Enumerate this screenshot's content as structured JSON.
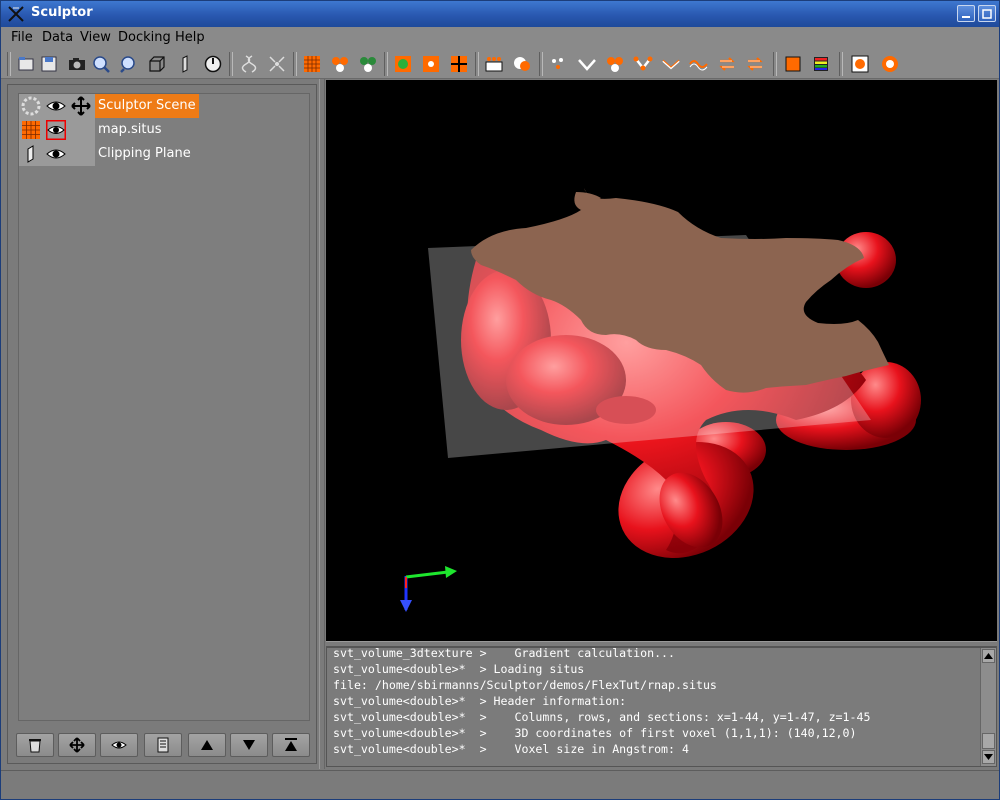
{
  "window": {
    "title": "Sculptor"
  },
  "menubar": {
    "items": [
      "File",
      "Data",
      "View",
      "Docking",
      "Help"
    ]
  },
  "toolbar": {
    "buttons": [
      "open-file-icon",
      "save-file-icon",
      "screenshot-icon",
      "zoom-in-icon",
      "zoom-out-icon",
      "box-icon",
      "clipping-plane-icon",
      "clock-icon",
      "dna-icon",
      "move-icon",
      "volume-grid-icon",
      "atoms-red-icon",
      "atoms-green-icon",
      "node-icon",
      "marker-grid-icon",
      "crosshair-icon",
      "piano-icon",
      "sphere-pair-icon",
      "points-icon",
      "connect-v-icon",
      "cluster-icon",
      "tree-icon",
      "chevron-icon",
      "wave-icon",
      "swap-icon",
      "swap-alt-icon",
      "orange-square-icon",
      "palette-icon",
      "render-icon",
      "settings-render-icon"
    ]
  },
  "tree": {
    "items": [
      {
        "label": "Sculptor Scene",
        "selected": true
      },
      {
        "label": "map.situs",
        "selected": false
      },
      {
        "label": "Clipping Plane",
        "selected": false
      }
    ]
  },
  "bottom_buttons": [
    "trash-icon",
    "move-icon",
    "eye-icon",
    "document-icon",
    "arrow-up-icon",
    "arrow-down-icon",
    "arrow-top-icon"
  ],
  "console": {
    "lines": [
      "svt_volume_3dtexture >    Gradient calculation...",
      "svt_volume<double>*  > Loading situs",
      "file: /home/sbirmanns/Sculptor/demos/FlexTut/rnap.situs",
      "svt_volume<double>*  > Header information:",
      "svt_volume<double>*  >    Columns, rows, and sections: x=1-44, y=1-47, z=1-45",
      "svt_volume<double>*  >    3D coordinates of first voxel (1,1,1): (140,12,0)",
      "svt_volume<double>*  >    Voxel size in Angstrom: 4"
    ]
  },
  "colors": {
    "title_bar": "#2958b0",
    "selection": "#ee7b16",
    "density_map": "#e8121c",
    "clip_surface": "#8c6450",
    "viewport_bg": "#000000"
  }
}
